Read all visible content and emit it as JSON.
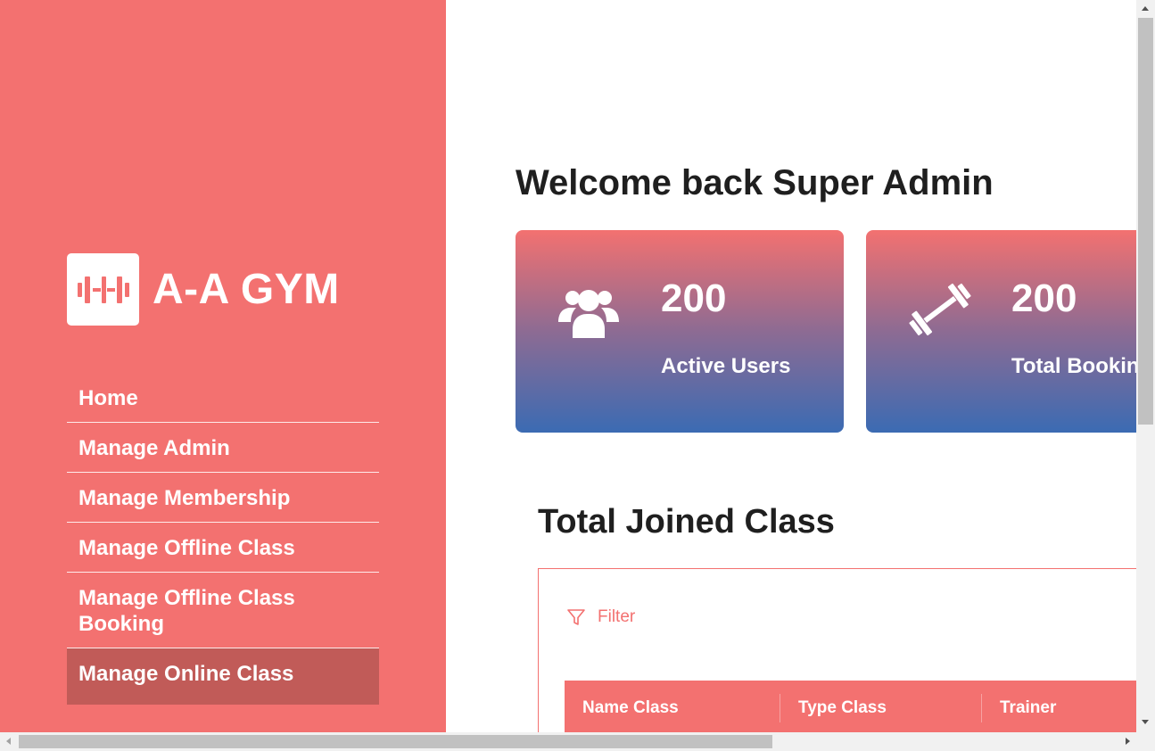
{
  "brand": {
    "name": "A-A GYM",
    "logo_icon": "dumbbell-icon"
  },
  "nav": {
    "items": [
      {
        "label": "Home",
        "active": false
      },
      {
        "label": "Manage Admin",
        "active": false
      },
      {
        "label": "Manage Membership",
        "active": false
      },
      {
        "label": "Manage Offline Class",
        "active": false
      },
      {
        "label": "Manage Offline Class Booking",
        "active": false
      },
      {
        "label": "Manage Online Class",
        "active": true
      }
    ]
  },
  "main": {
    "welcome": "Welcome back Super Admin",
    "stats": [
      {
        "value": "200",
        "label": "Active Users",
        "icon": "users-icon"
      },
      {
        "value": "200",
        "label": "Total Bookin",
        "icon": "barbell-icon"
      }
    ],
    "section_title": "Total Joined Class",
    "filter_label": "Filter",
    "table": {
      "columns": [
        "Name Class",
        "Type Class",
        "Trainer"
      ]
    }
  },
  "colors": {
    "sidebar": "#f37170",
    "sidebar_active": "#c15b58",
    "card_gradient_top": "#f37170",
    "card_gradient_bottom": "#3b6bb3",
    "text_dark": "#1f1f1f"
  }
}
